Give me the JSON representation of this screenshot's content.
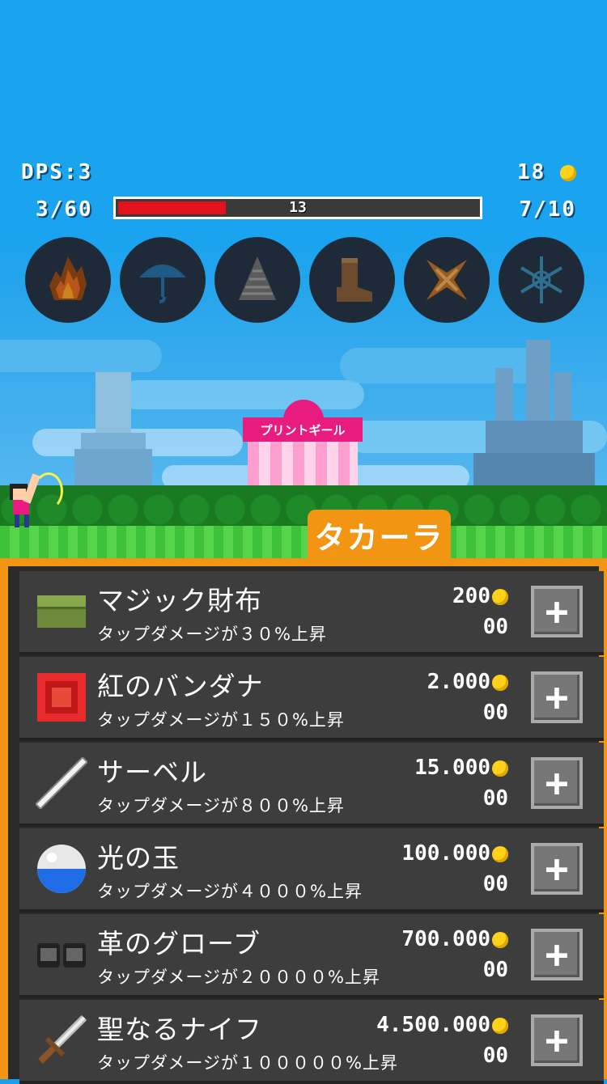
{
  "hud": {
    "dps": "DPS:3",
    "coins": "18",
    "stage_progress": "3/60",
    "hp_value": "13",
    "hp_fraction": 0.3,
    "wave_progress": "7/10"
  },
  "skills": [
    {
      "icon": "fire-icon"
    },
    {
      "icon": "umbrella-icon"
    },
    {
      "icon": "drill-icon"
    },
    {
      "icon": "boot-icon"
    },
    {
      "icon": "shuriken-icon"
    },
    {
      "icon": "snowflake-icon"
    }
  ],
  "scene": {
    "store_sign": "プリントギール"
  },
  "shop": {
    "tab_label": "タカーラ",
    "items": [
      {
        "name": "マジック財布",
        "desc": "タップダメージが３０%上昇",
        "price": "200",
        "owned": "00",
        "icon": "wallet-icon"
      },
      {
        "name": "紅のバンダナ",
        "desc": "タップダメージが１５０%上昇",
        "price": "2.000",
        "owned": "00",
        "icon": "bandana-icon"
      },
      {
        "name": "サーベル",
        "desc": "タップダメージが８００%上昇",
        "price": "15.000",
        "owned": "00",
        "icon": "saber-icon"
      },
      {
        "name": "光の玉",
        "desc": "タップダメージが４０００%上昇",
        "price": "100.000",
        "owned": "00",
        "icon": "orb-icon"
      },
      {
        "name": "革のグローブ",
        "desc": "タップダメージが２００００%上昇",
        "price": "700.000",
        "owned": "00",
        "icon": "gloves-icon"
      },
      {
        "name": "聖なるナイフ",
        "desc": "タップダメージが１０００００%上昇",
        "price": "4.500.000",
        "owned": "00",
        "icon": "knife-icon"
      }
    ]
  }
}
